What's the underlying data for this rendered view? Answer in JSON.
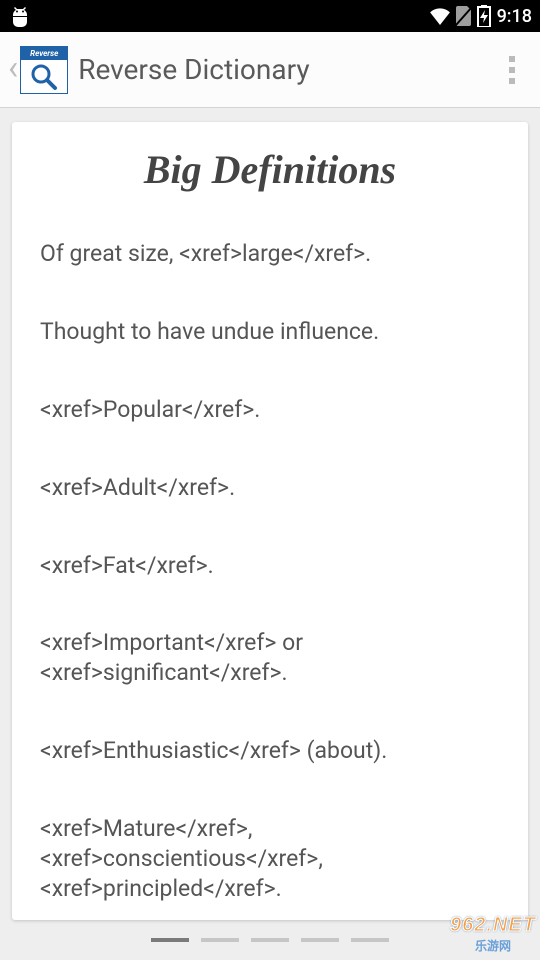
{
  "status": {
    "time": "9:18"
  },
  "appbar": {
    "icon_banner": "Reverse Dict.",
    "title": "Reverse Dictionary"
  },
  "card": {
    "heading": "Big Definitions",
    "definitions": [
      "Of great size, <xref>large</xref>.",
      "Thought to have undue influence.",
      "<xref>Popular</xref>.",
      "<xref>Adult</xref>.",
      "<xref>Fat</xref>.",
      "<xref>Important</xref> or <xref>significant</xref>.",
      "<xref>Enthusiastic</xref> (about).",
      "<xref>Mature</xref>, <xref>conscientious</xref>, <xref>principled</xref>."
    ]
  },
  "pager": {
    "count": 5,
    "active": 0
  },
  "watermark": {
    "domain": "962.NET",
    "sub": "乐游网"
  }
}
